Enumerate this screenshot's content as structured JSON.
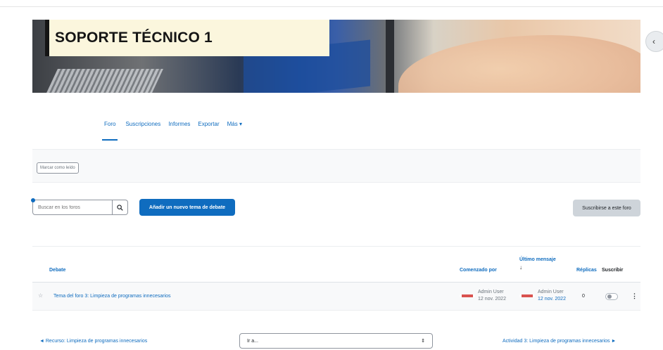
{
  "course": {
    "title": "SOPORTE TÉCNICO 1"
  },
  "drawer": {
    "toggle_icon": "‹"
  },
  "nav": {
    "tabs": [
      {
        "label": "Foro",
        "active": true
      },
      {
        "label": "Suscripciones"
      },
      {
        "label": "Informes"
      },
      {
        "label": "Exportar"
      },
      {
        "label": "Más ▾"
      }
    ]
  },
  "toolbar": {
    "mark_read_label": "Marcar como leído"
  },
  "search": {
    "placeholder": "Buscar en los foros"
  },
  "actions": {
    "add_topic_label": "Añadir un nuevo tema de debate",
    "subscribe_forum_label": "Suscribirse a este foro"
  },
  "table": {
    "headers": {
      "discussion": "Debate",
      "started_by": "Comenzado por",
      "last_post": "Último mensaje",
      "last_post_arrow": "↓",
      "replies": "Réplicas",
      "subscribe": "Suscribir"
    },
    "rows": [
      {
        "topic": "Tema del foro 3: Limpieza de programas innecesarios",
        "started_by_name": "Admin User",
        "started_by_date": "12 nov. 2022",
        "last_post_name": "Admin User",
        "last_post_date": "12 nov. 2022",
        "replies": "0"
      }
    ]
  },
  "footer": {
    "prev_label": "◄ Recurso: Limpieza de programas innecesarios",
    "jump_value": "Ir a...",
    "next_label": "Actividad 3: Limpieza de programas innecesarios ►"
  },
  "colors": {
    "primary": "#0f6cbf",
    "title_bg": "#fbf6dd",
    "secondary_button": "#ced4da"
  }
}
